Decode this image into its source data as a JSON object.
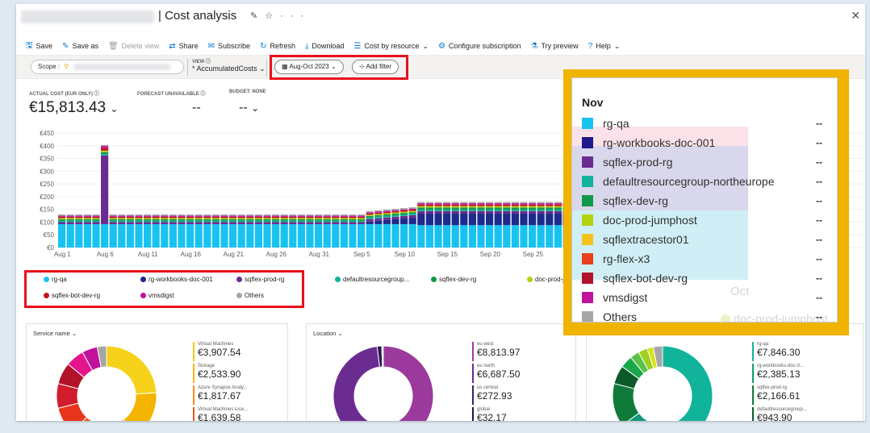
{
  "header": {
    "title": "| Cost analysis"
  },
  "toolbar": {
    "items": [
      {
        "label": "Save",
        "icon": "save-icon",
        "glyph": "🖫",
        "disabled": false
      },
      {
        "label": "Save as",
        "icon": "save-as-icon",
        "glyph": "✎",
        "disabled": false
      },
      {
        "label": "Delete view",
        "icon": "delete-icon",
        "glyph": "🗑",
        "disabled": true
      },
      {
        "label": "Share",
        "icon": "share-icon",
        "glyph": "⇄",
        "disabled": false
      },
      {
        "label": "Subscribe",
        "icon": "mail-icon",
        "glyph": "✉",
        "disabled": false
      },
      {
        "label": "Refresh",
        "icon": "refresh-icon",
        "glyph": "↻",
        "disabled": false
      },
      {
        "label": "Download",
        "icon": "download-icon",
        "glyph": "⤓",
        "disabled": false
      },
      {
        "label": "Cost by resource",
        "icon": "list-icon",
        "glyph": "☰",
        "disabled": false,
        "chevron": true
      },
      {
        "label": "Configure subscription",
        "icon": "gear-icon",
        "glyph": "⚙",
        "disabled": false
      },
      {
        "label": "Try preview",
        "icon": "flask-icon",
        "glyph": "⚗",
        "disabled": false
      },
      {
        "label": "Help",
        "icon": "help-icon",
        "glyph": "?",
        "disabled": false,
        "chevron": true
      }
    ]
  },
  "filters": {
    "scope_label": "Scope :",
    "view_label": "VIEW",
    "view_value": "* AccumulatedCosts",
    "date_range": "Aug-Oct 2023",
    "add_filter": "Add filter"
  },
  "kpis": {
    "actual_label": "ACTUAL COST (EUR ONLY)",
    "actual_value": "€15,813.43",
    "forecast_label": "FORECAST UNAVAILABLE",
    "forecast_value": "--",
    "budget_label": "BUDGET: NONE",
    "budget_value": "--"
  },
  "chart_data": {
    "type": "bar",
    "stacked": true,
    "y_ticks": [
      "€0",
      "€50",
      "€100",
      "€150",
      "€200",
      "€250",
      "€300",
      "€350",
      "€400",
      "€450"
    ],
    "ylim": [
      0,
      450
    ],
    "x_ticks": [
      "Aug 1",
      "Aug 6",
      "Aug 11",
      "Aug 16",
      "Aug 21",
      "Aug 26",
      "Aug 31",
      "Sep 5",
      "Sep 10",
      "Sep 15",
      "Sep 20",
      "Sep 25"
    ],
    "series": [
      {
        "name": "rg-qa",
        "color": "#19c3f0"
      },
      {
        "name": "rg-workbooks-doc-001",
        "color": "#1c2b8c"
      },
      {
        "name": "sqflex-prod-rg",
        "color": "#6b2c91"
      },
      {
        "name": "defaultresourcegroup...",
        "color": "#11b39b"
      },
      {
        "name": "sqflex-dev-rg",
        "color": "#0f9a4a"
      },
      {
        "name": "doc-prod-jumphost",
        "color": "#b4d10f"
      },
      {
        "name": "sqflex-bot-dev-rg",
        "color": "#c4151c"
      },
      {
        "name": "vmsdigst",
        "color": "#c0129b"
      },
      {
        "name": "Others",
        "color": "#a6a6a6"
      }
    ],
    "daily_total_phase1": 130,
    "daily_total_phase2": 185,
    "spike_value": 410
  },
  "legend_bottom": [
    {
      "label": "rg-qa",
      "color": "#19c3f0"
    },
    {
      "label": "rg-workbooks-doc-001",
      "color": "#1c2b8c"
    },
    {
      "label": "sqflex-prod-rg",
      "color": "#6b2c91"
    },
    {
      "label": "defaultresourcegroup...",
      "color": "#11b39b"
    },
    {
      "label": "sqflex-dev-rg",
      "color": "#0f9a4a"
    },
    {
      "label": "doc-prod-jump...",
      "color": "#b4d10f"
    },
    {
      "label": "sqflex-bot-dev-rg",
      "color": "#c4151c"
    },
    {
      "label": "vmsdigst",
      "color": "#c0129b"
    },
    {
      "label": "Others",
      "color": "#a6a6a6"
    }
  ],
  "cards": {
    "service": {
      "title": "Service name",
      "items": [
        {
          "name": "Virtual Machines",
          "value": "€3,907.54",
          "color": "#f7c71b"
        },
        {
          "name": "Storage",
          "value": "€2,533.90",
          "color": "#f4b400"
        },
        {
          "name": "Azure Synapse Analy...",
          "value": "€1,817.67",
          "color": "#f08c1e"
        },
        {
          "name": "Virtual Machines Lice...",
          "value": "€1,639.58",
          "color": "#e55a1a"
        }
      ],
      "slices": [
        {
          "v": 24,
          "color": "#f7d21b"
        },
        {
          "v": 16,
          "color": "#f4b400"
        },
        {
          "v": 12,
          "color": "#f08c1e"
        },
        {
          "v": 10,
          "color": "#e55a1a"
        },
        {
          "v": 9,
          "color": "#e8341c"
        },
        {
          "v": 8,
          "color": "#d01c2c"
        },
        {
          "v": 7,
          "color": "#b3122a"
        },
        {
          "v": 6,
          "color": "#e4158c"
        },
        {
          "v": 5,
          "color": "#c0129b"
        },
        {
          "v": 3,
          "color": "#a6a6a6"
        }
      ]
    },
    "location": {
      "title": "Location",
      "items": [
        {
          "name": "eu west",
          "value": "€8,813.97",
          "color": "#9b3a9c"
        },
        {
          "name": "eu north",
          "value": "€6,687.50",
          "color": "#6b2c91"
        },
        {
          "name": "us central",
          "value": "€272.93",
          "color": "#3d1f6e"
        },
        {
          "name": "global",
          "value": "€32.17",
          "color": "#2a1550"
        }
      ],
      "slices": [
        {
          "v": 55,
          "color": "#9b3a9c"
        },
        {
          "v": 43,
          "color": "#6b2c91"
        },
        {
          "v": 1.5,
          "color": "#2a1550"
        },
        {
          "v": 0.5,
          "color": "#ccc"
        }
      ]
    },
    "resource": {
      "title": "",
      "items": [
        {
          "name": "rg-qa",
          "value": "€7,846.30",
          "color": "#11b39b"
        },
        {
          "name": "rg-workbooks-doc-0...",
          "value": "€2,385.13",
          "color": "#0f9a7a"
        },
        {
          "name": "sqflex-prod-rg",
          "value": "€2,166.61",
          "color": "#0f7a3a"
        },
        {
          "name": "defaultresourcegroup...",
          "value": "€943.90",
          "color": "#0c5a2a"
        }
      ],
      "slices": [
        {
          "v": 50,
          "color": "#11b39b"
        },
        {
          "v": 15,
          "color": "#0f9a7a"
        },
        {
          "v": 14,
          "color": "#0f7a3a"
        },
        {
          "v": 6,
          "color": "#0c5a2a"
        },
        {
          "v": 4,
          "color": "#18a84a"
        },
        {
          "v": 3,
          "color": "#5cc14a"
        },
        {
          "v": 3,
          "color": "#9ed11f"
        },
        {
          "v": 2,
          "color": "#d9e21a"
        },
        {
          "v": 3,
          "color": "#a6a6a6"
        }
      ]
    }
  },
  "popup": {
    "title": "Nov",
    "bg_text_month": "Oct",
    "bg_text_legend": "doc-prod-jumphost",
    "bg_text_vmsdigst": "vmsdigst",
    "items": [
      {
        "label": "rg-qa",
        "color": "#19c3f0",
        "value": "--"
      },
      {
        "label": "rg-workbooks-doc-001",
        "color": "#1c1a8c",
        "value": "--"
      },
      {
        "label": "sqflex-prod-rg",
        "color": "#6b2c91",
        "value": "--"
      },
      {
        "label": "defaultresourcegroup-northeurope",
        "color": "#11b39b",
        "value": "--"
      },
      {
        "label": "sqflex-dev-rg",
        "color": "#0f9a4a",
        "value": "--"
      },
      {
        "label": "doc-prod-jumphost",
        "color": "#b4d10f",
        "value": "--"
      },
      {
        "label": "sqflextracestor01",
        "color": "#f4c21a",
        "value": "--"
      },
      {
        "label": "rg-flex-x3",
        "color": "#e8401c",
        "value": "--"
      },
      {
        "label": "sqflex-bot-dev-rg",
        "color": "#b3122a",
        "value": "--"
      },
      {
        "label": "vmsdigst",
        "color": "#c0129b",
        "value": "--"
      },
      {
        "label": "Others",
        "color": "#a6a6a6",
        "value": "--"
      }
    ]
  }
}
